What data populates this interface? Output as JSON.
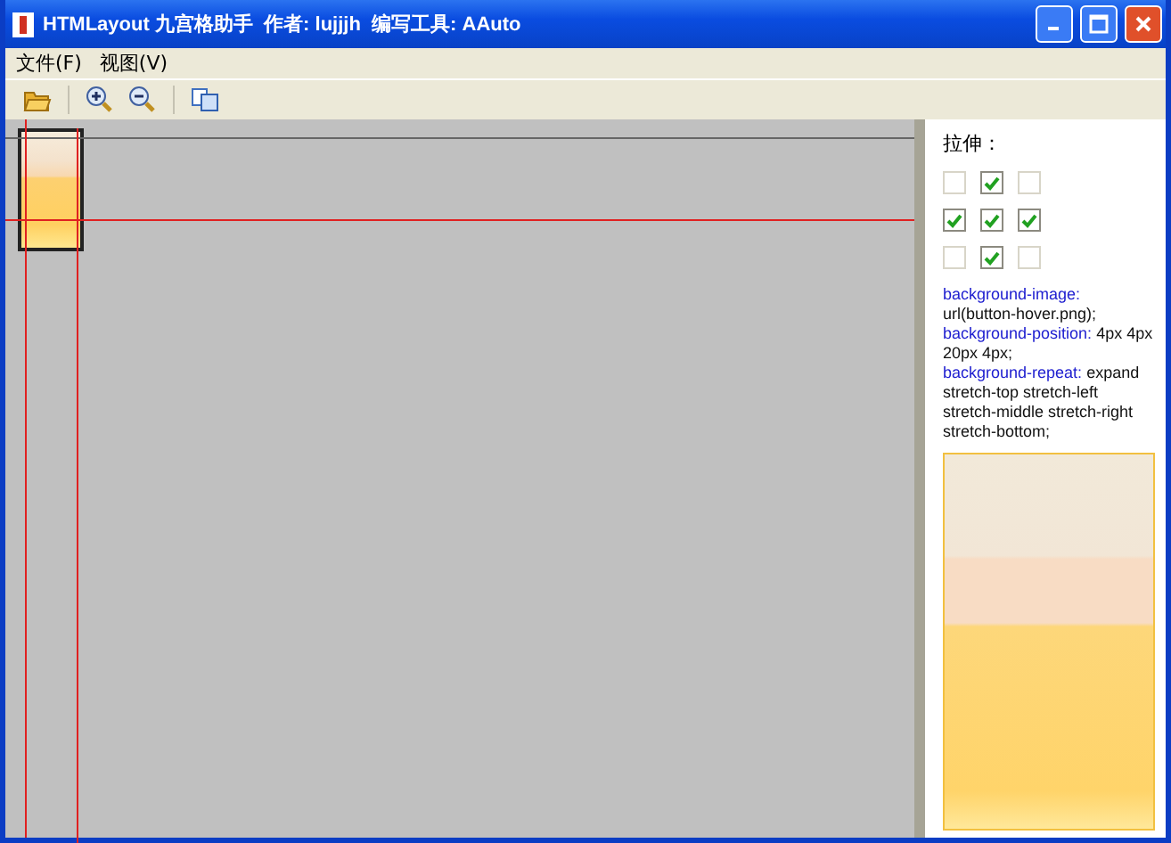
{
  "window": {
    "title": "HTMLayout 九宫格助手  作者: lujjjh  编写工具: AAuto"
  },
  "menu": [
    "文件(F)",
    "视图(V)"
  ],
  "panel": {
    "heading": "拉伸：",
    "grid": [
      [
        {
          "checked": false
        },
        {
          "checked": true
        },
        {
          "checked": false
        }
      ],
      [
        {
          "checked": true
        },
        {
          "checked": true
        },
        {
          "checked": true
        }
      ],
      [
        {
          "checked": false
        },
        {
          "checked": true
        },
        {
          "checked": false
        }
      ]
    ],
    "declarations": [
      {
        "property": "background-image:",
        "value": "url(button-hover.png);"
      },
      {
        "property": "background-position:",
        "value": "4px 4px 20px 4px;"
      },
      {
        "property": "background-repeat:",
        "value": "expand stretch-top stretch-left stretch-middle stretch-right stretch-bottom;"
      }
    ]
  }
}
